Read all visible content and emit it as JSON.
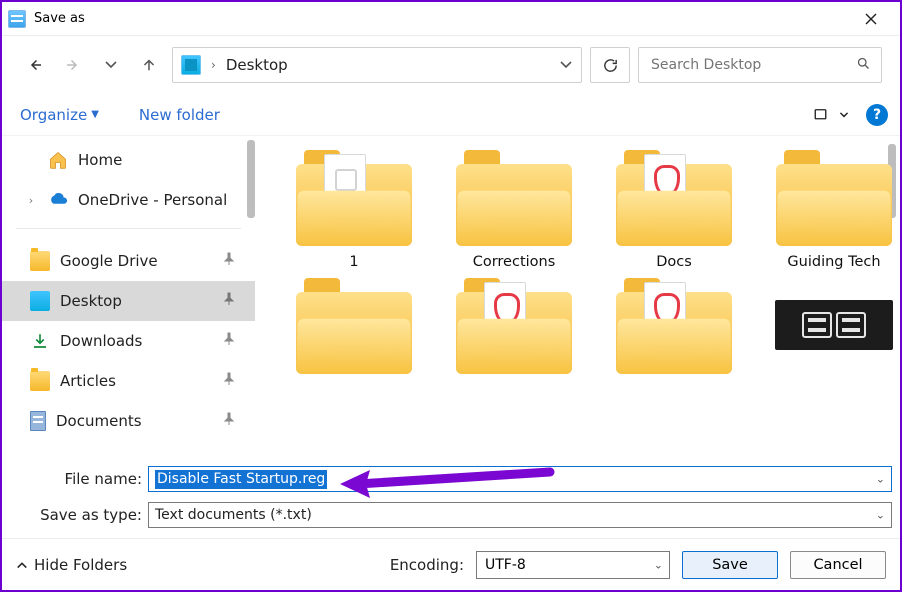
{
  "title": "Save as",
  "nav": {
    "location": "Desktop",
    "search_placeholder": "Search Desktop"
  },
  "toolbar": {
    "organize": "Organize",
    "newfolder": "New folder",
    "help": "?"
  },
  "sidebar": {
    "home": "Home",
    "onedrive": "OneDrive - Personal",
    "items": [
      {
        "label": "Google Drive"
      },
      {
        "label": "Desktop"
      },
      {
        "label": "Downloads"
      },
      {
        "label": "Articles"
      },
      {
        "label": "Documents"
      }
    ]
  },
  "tiles": [
    {
      "label": "1",
      "kind": "stat"
    },
    {
      "label": "Corrections",
      "kind": "plain"
    },
    {
      "label": "Docs",
      "kind": "pdf"
    },
    {
      "label": "Guiding Tech",
      "kind": "empty"
    },
    {
      "label": "",
      "kind": "plain"
    },
    {
      "label": "",
      "kind": "pdf"
    },
    {
      "label": "",
      "kind": "pdf"
    },
    {
      "label": "",
      "kind": "dark"
    }
  ],
  "form": {
    "filename_label": "File name:",
    "filename_value": "Disable Fast Startup.reg",
    "type_label": "Save as type:",
    "type_value": "Text documents (*.txt)"
  },
  "footer": {
    "hide_folders": "Hide Folders",
    "encoding_label": "Encoding:",
    "encoding_value": "UTF-8",
    "save": "Save",
    "cancel": "Cancel"
  }
}
